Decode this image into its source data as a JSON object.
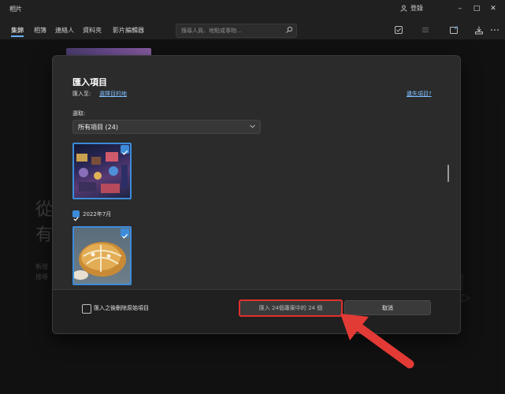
{
  "app": {
    "title": "相片",
    "signin": "登錄"
  },
  "nav": {
    "items": [
      "集錦",
      "相簿",
      "連絡人",
      "資料夾",
      "影片編輯器"
    ]
  },
  "search": {
    "placeholder": "搜尋人員、地點或事物..."
  },
  "background": {
    "big1": "從",
    "big2": "有",
    "line1": "新增",
    "line2": "搜尋"
  },
  "dialog": {
    "title": "匯入項目",
    "destination_label": "匯入至:",
    "destination_link": "選擇目的地",
    "missing_link": "遺失項目?",
    "select_label": "選取:",
    "dropdown_value": "所有項目 (24)",
    "group_label": "2022年7月",
    "delete_label": "匯入之後刪除原始項目",
    "import_button": "匯入 24個專案中的 24 個",
    "cancel_button": "取消"
  },
  "colors": {
    "accent": "#3d8bd9",
    "highlight": "#e0312d",
    "link": "#7fc0ff"
  }
}
